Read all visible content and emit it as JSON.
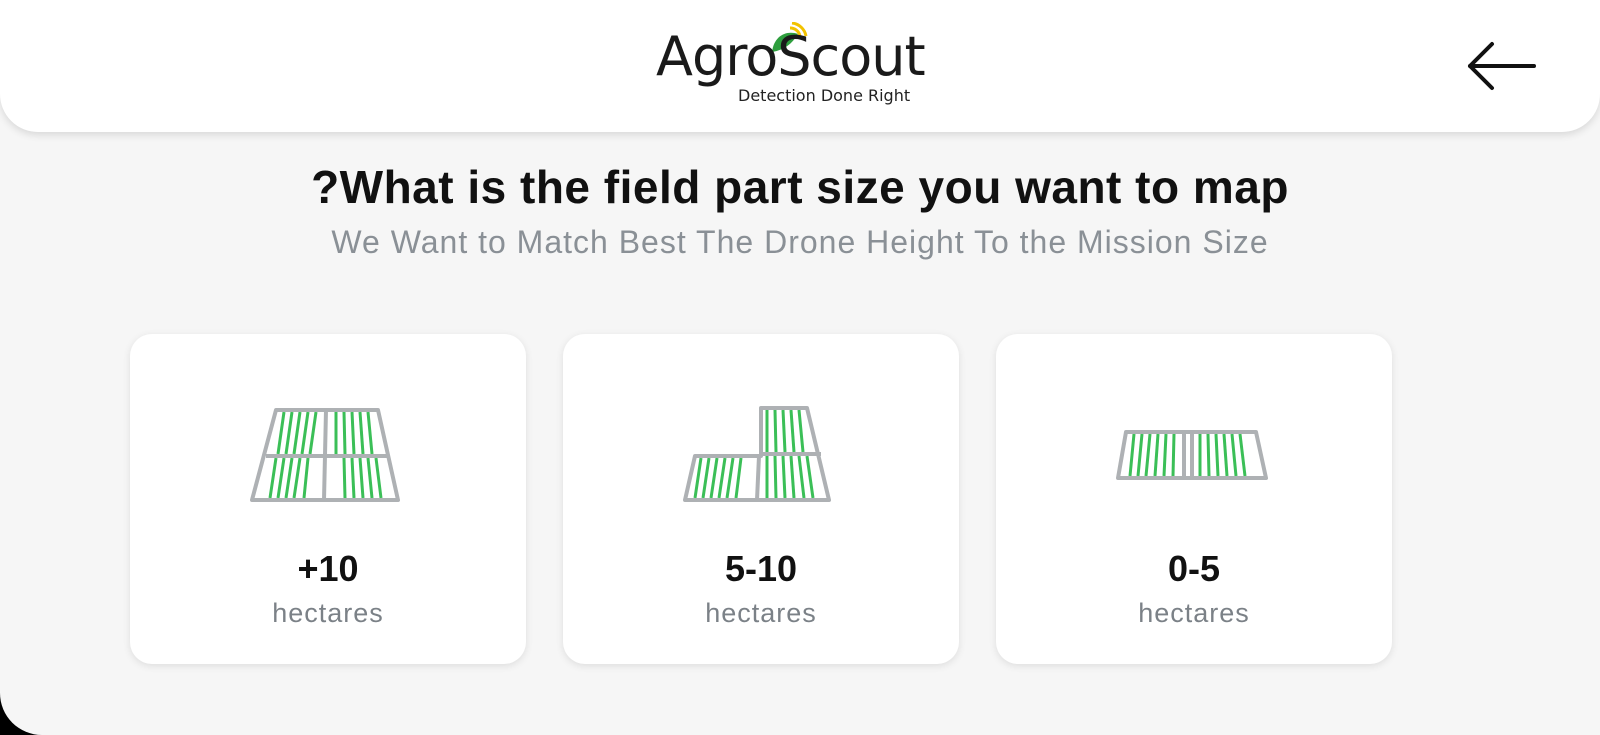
{
  "header": {
    "logo_text": "AgroScout",
    "logo_tagline": "Detection Done Right",
    "back_icon": "arrow-left-icon"
  },
  "main": {
    "title": "?What is the field part size you want to map",
    "subtitle": "We Want to Match Best The Drone Height To the Mission Size"
  },
  "options": [
    {
      "value": "+10",
      "unit": "hectares",
      "icon": "large-field-icon"
    },
    {
      "value": "5-10",
      "unit": "hectares",
      "icon": "medium-field-icon"
    },
    {
      "value": "0-5",
      "unit": "hectares",
      "icon": "small-field-icon"
    }
  ],
  "colors": {
    "brand_green": "#3bbf57",
    "field_gray": "#aeb1b4",
    "leaf_green": "#2e9e3e",
    "signal_yellow": "#f2c200"
  }
}
